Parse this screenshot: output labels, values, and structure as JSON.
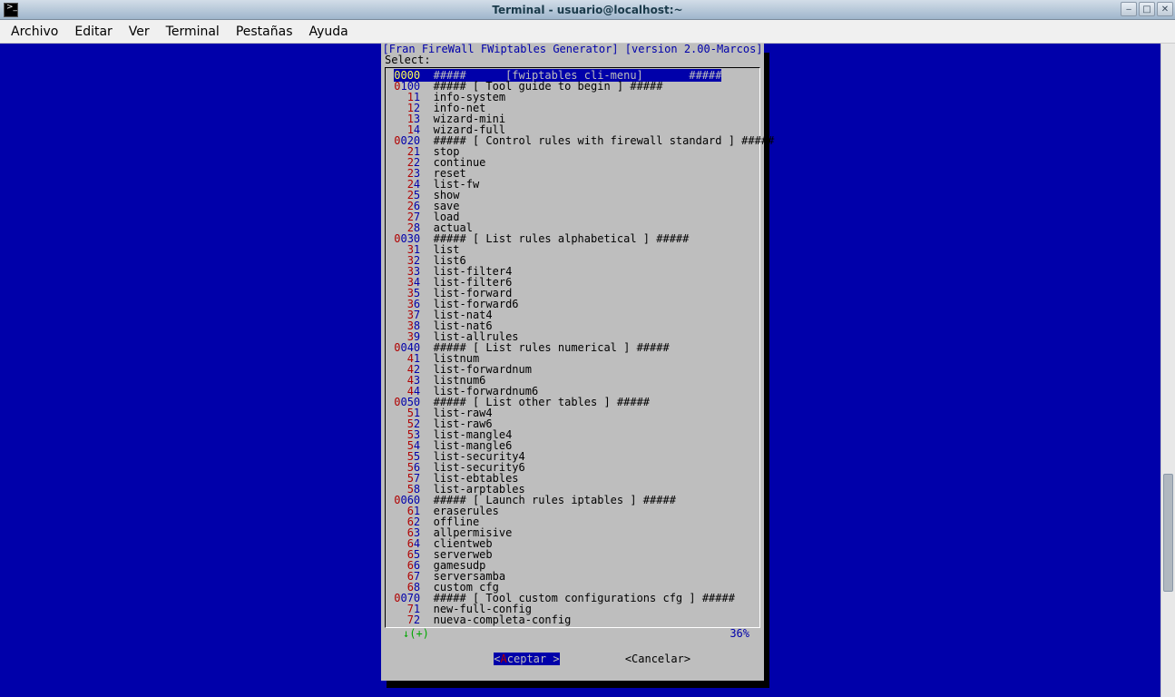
{
  "window": {
    "title": "Terminal - usuario@localhost:~"
  },
  "menu": {
    "items": [
      "Archivo",
      "Editar",
      "Ver",
      "Terminal",
      "Pestañas",
      "Ayuda"
    ]
  },
  "dialog": {
    "header": "[Fran FireWall FWiptables Generator] [version 2.00-Marcos]",
    "prompt": "Select:",
    "scroll_indicator": "↓(+)",
    "percent": "36%",
    "accept_pre": "<",
    "accept_hot": "A",
    "accept_rest": "ceptar >",
    "cancel": "<Cancelar>",
    "items": [
      {
        "n": "0000",
        "label": "#####      [fwiptables cli-menu]       #####",
        "selected": true,
        "hdr": true
      },
      {
        "n": "0100",
        "label": "##### [ Tool guide to begin ] #####",
        "hdr": true
      },
      {
        "n": "11",
        "label": "info-system"
      },
      {
        "n": "12",
        "label": "info-net"
      },
      {
        "n": "13",
        "label": "wizard-mini"
      },
      {
        "n": "14",
        "label": "wizard-full"
      },
      {
        "n": "0020",
        "label": "##### [ Control rules with firewall standard ] #####",
        "hdr": true
      },
      {
        "n": "21",
        "label": "stop"
      },
      {
        "n": "22",
        "label": "continue"
      },
      {
        "n": "23",
        "label": "reset"
      },
      {
        "n": "24",
        "label": "list-fw"
      },
      {
        "n": "25",
        "label": "show"
      },
      {
        "n": "26",
        "label": "save"
      },
      {
        "n": "27",
        "label": "load"
      },
      {
        "n": "28",
        "label": "actual"
      },
      {
        "n": "0030",
        "label": "##### [ List rules alphabetical ] #####",
        "hdr": true
      },
      {
        "n": "31",
        "label": "list"
      },
      {
        "n": "32",
        "label": "list6"
      },
      {
        "n": "33",
        "label": "list-filter4"
      },
      {
        "n": "34",
        "label": "list-filter6"
      },
      {
        "n": "35",
        "label": "list-forward"
      },
      {
        "n": "36",
        "label": "list-forward6"
      },
      {
        "n": "37",
        "label": "list-nat4"
      },
      {
        "n": "38",
        "label": "list-nat6"
      },
      {
        "n": "39",
        "label": "list-allrules"
      },
      {
        "n": "0040",
        "label": "##### [ List rules numerical ] #####",
        "hdr": true
      },
      {
        "n": "41",
        "label": "listnum"
      },
      {
        "n": "42",
        "label": "list-forwardnum"
      },
      {
        "n": "43",
        "label": "listnum6"
      },
      {
        "n": "44",
        "label": "list-forwardnum6"
      },
      {
        "n": "0050",
        "label": "##### [ List other tables ] #####",
        "hdr": true
      },
      {
        "n": "51",
        "label": "list-raw4"
      },
      {
        "n": "52",
        "label": "list-raw6"
      },
      {
        "n": "53",
        "label": "list-mangle4"
      },
      {
        "n": "54",
        "label": "list-mangle6"
      },
      {
        "n": "55",
        "label": "list-security4"
      },
      {
        "n": "56",
        "label": "list-security6"
      },
      {
        "n": "57",
        "label": "list-ebtables"
      },
      {
        "n": "58",
        "label": "list-arptables"
      },
      {
        "n": "0060",
        "label": "##### [ Launch rules iptables ] #####",
        "hdr": true
      },
      {
        "n": "61",
        "label": "eraserules"
      },
      {
        "n": "62",
        "label": "offline"
      },
      {
        "n": "63",
        "label": "allpermisive"
      },
      {
        "n": "64",
        "label": "clientweb"
      },
      {
        "n": "65",
        "label": "serverweb"
      },
      {
        "n": "66",
        "label": "gamesudp"
      },
      {
        "n": "67",
        "label": "serversamba"
      },
      {
        "n": "68",
        "label": "custom cfg"
      },
      {
        "n": "0070",
        "label": "##### [ Tool custom configurations cfg ] #####",
        "hdr": true
      },
      {
        "n": "71",
        "label": "new-full-config"
      },
      {
        "n": "72",
        "label": "nueva-completa-config"
      }
    ]
  }
}
